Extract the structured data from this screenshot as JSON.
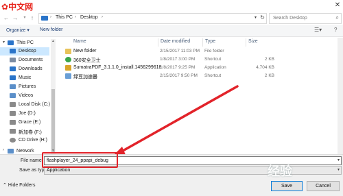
{
  "watermark": {
    "logo_text": "中文网",
    "bottom_text": "经验"
  },
  "address_bar": {
    "crumbs": [
      "This PC",
      "Desktop"
    ],
    "search_placeholder": "Search Desktop"
  },
  "toolbar": {
    "organize_label": "Organize",
    "new_folder_label": "New folder"
  },
  "sidebar": {
    "items": [
      {
        "label": "This PC",
        "icon": "computer-icon",
        "color": "#2a74c9"
      },
      {
        "label": "Desktop",
        "icon": "desktop-icon",
        "color": "#2a74c9",
        "selected": true
      },
      {
        "label": "Documents",
        "icon": "documents-icon",
        "color": "#7b8ca3"
      },
      {
        "label": "Downloads",
        "icon": "downloads-icon",
        "color": "#2a74c9"
      },
      {
        "label": "Music",
        "icon": "music-icon",
        "color": "#2a74c9"
      },
      {
        "label": "Pictures",
        "icon": "pictures-icon",
        "color": "#5b8fc9"
      },
      {
        "label": "Videos",
        "icon": "videos-icon",
        "color": "#5b8fc9"
      },
      {
        "label": "Local Disk (C:)",
        "icon": "drive-icon",
        "color": "#8a8a8a"
      },
      {
        "label": "Joe (D:)",
        "icon": "drive-icon",
        "color": "#8a8a8a"
      },
      {
        "label": "Grace (E:)",
        "icon": "drive-icon",
        "color": "#8a8a8a"
      },
      {
        "label": "新加卷 (F:)",
        "icon": "drive-icon",
        "color": "#8a8a8a"
      },
      {
        "label": "CD Drive (H:)",
        "icon": "cd-drive-icon",
        "color": "#8a8a8a"
      },
      {
        "label": "Network",
        "icon": "network-icon",
        "color": "#5b8fc9"
      }
    ]
  },
  "columns": {
    "name": "Name",
    "date": "Date modified",
    "type": "Type",
    "size": "Size"
  },
  "files": [
    {
      "name": "New folder",
      "date": "2/15/2017 11:03 PM",
      "type": "File folder",
      "size": "",
      "icon": "folder-icon",
      "color": "#e8c35a"
    },
    {
      "name": "360安全卫士",
      "date": "1/8/2017 3:00 PM",
      "type": "Shortcut",
      "size": "2 KB",
      "icon": "shortcut-icon",
      "color": "#3ba54a"
    },
    {
      "name": "SumatraPDF_3.1.1.0_install.1456299618",
      "date": "1/8/2017 9:25 PM",
      "type": "Application",
      "size": "4,704 KB",
      "icon": "app-icon",
      "color": "#d9a52a"
    },
    {
      "name": "绿豆加速器",
      "date": "2/15/2017 9:50 PM",
      "type": "Shortcut",
      "size": "2 KB",
      "icon": "shortcut-icon",
      "color": "#6a9fd6"
    }
  ],
  "form": {
    "file_name_label": "File name:",
    "file_name_value": "flashplayer_24_ppapi_debug",
    "save_as_type_label": "Save as type:",
    "save_as_type_value": "Application",
    "hide_folders_label": "Hide Folders",
    "save_label": "Save",
    "cancel_label": "Cancel"
  },
  "annotation_color": "#e2232a"
}
